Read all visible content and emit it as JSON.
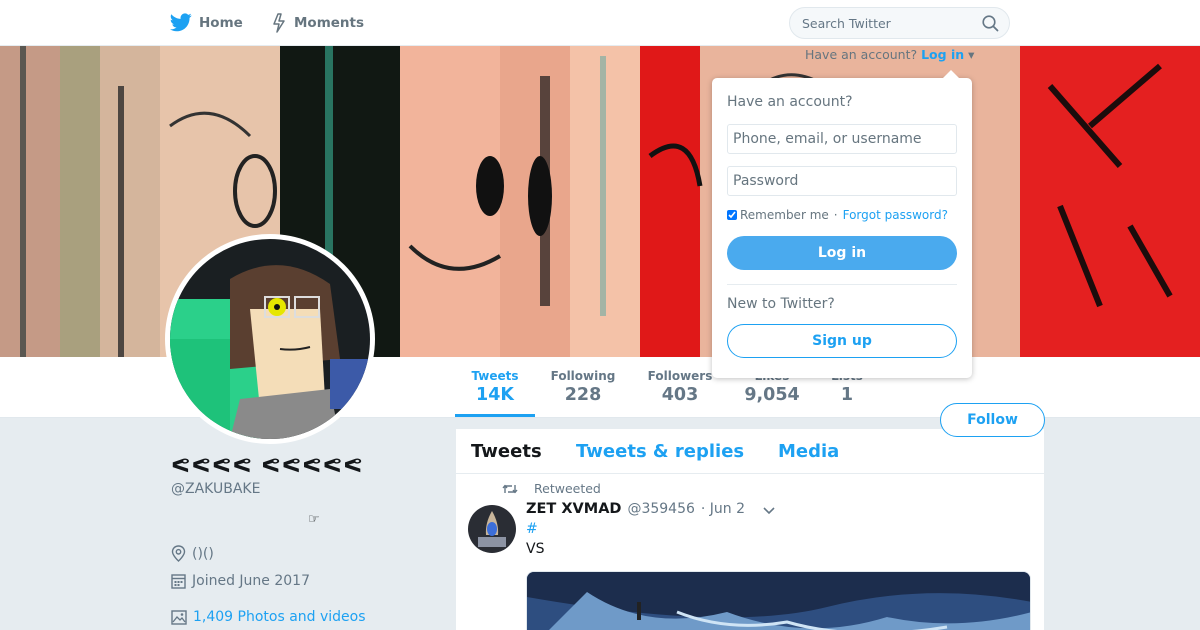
{
  "nav": {
    "home_label": "Home",
    "moments_label": "Moments",
    "home_icon": "twitter-bird-icon",
    "moments_icon": "lightning-icon",
    "search_placeholder": "Search Twitter",
    "have_account_text": "Have an account?",
    "login_link": "Log in"
  },
  "profile": {
    "name": "ᕙᕙᕙᕙ ᕙᕙᕙᕙᕙ",
    "handle": "@ZAKUBAKE",
    "bio": "☞",
    "location": "()()",
    "joined": "Joined June 2017",
    "photos": "1,409 Photos and videos"
  },
  "stats": [
    {
      "label": "Tweets",
      "value": "14K"
    },
    {
      "label": "Following",
      "value": "228"
    },
    {
      "label": "Followers",
      "value": "403"
    },
    {
      "label": "Likes",
      "value": "9,054"
    },
    {
      "label": "Lists",
      "value": "1"
    }
  ],
  "follow_label": "Follow",
  "timeline": {
    "tabs": [
      "Tweets",
      "Tweets & replies",
      "Media"
    ],
    "retweeted_label": "Retweeted",
    "tweet": {
      "name": "ZET XVMAD",
      "username": "@359456",
      "date": "· Jun 2",
      "hashtag": "#",
      "text": "VS"
    }
  },
  "login_dropdown": {
    "title": "Have an account?",
    "username_placeholder": "Phone, email, or username",
    "password_placeholder": "Password",
    "remember": "Remember me",
    "separator": "·",
    "forgot": "Forgot password?",
    "login_button": "Log in",
    "new_text": "New to Twitter?",
    "signup_button": "Sign up"
  },
  "colors": {
    "accent": "#1da1f2",
    "login_button": "#4aaaee",
    "background": "#e6ecf0"
  }
}
